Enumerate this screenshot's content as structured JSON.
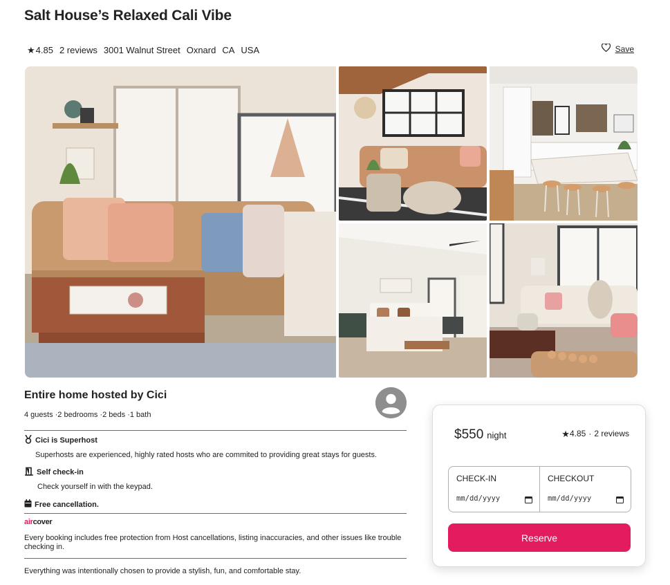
{
  "listing": {
    "title": "Salt House’s Relaxed Cali Vibe",
    "rating": "4.85",
    "reviews": "2 reviews",
    "street": "3001 Walnut Street",
    "city": "Oxnard",
    "state": "CA",
    "country": "USA",
    "save_label": "Save"
  },
  "host": {
    "title": "Entire home hosted by Cici",
    "details": "4 guests ·2 bedrooms ·2 beds ·1 bath"
  },
  "features": {
    "superhost_title": "Cici is Superhost",
    "superhost_desc": "Superhosts are experienced, highly rated hosts who are commited to providing great stays for guests.",
    "checkin_title": "Self check-in",
    "checkin_desc": "Check yourself in with the keypad.",
    "cancel_title": "Free cancellation."
  },
  "aircover": {
    "logo_air": "air",
    "logo_cover": "cover",
    "text": "Every booking includes free protection from Host cancellations, listing inaccuracies, and other issues like trouble checking in."
  },
  "footer_text": "Everything was intentionally chosen to provide a stylish, fun, and comfortable stay.",
  "booking": {
    "price": "$550",
    "unit": "night",
    "rating": "4.85",
    "separator": "·",
    "reviews": "2 reviews",
    "checkin_label": "CHECK-IN",
    "checkout_label": "CHECKOUT",
    "date_placeholder": "mm/dd/yyyy",
    "reserve_label": "Reserve"
  },
  "colors": {
    "accent": "#e31c5f",
    "text": "#222222",
    "rule": "#6b6b6b"
  },
  "icons": [
    "star-icon",
    "heart-icon",
    "medal-icon",
    "door-icon",
    "calendar-icon",
    "user-avatar-icon"
  ]
}
